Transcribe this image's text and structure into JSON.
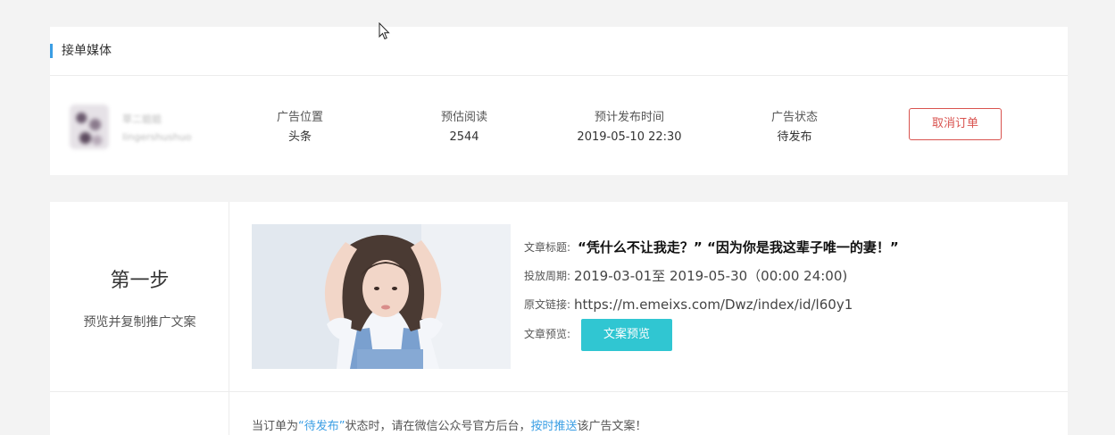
{
  "media_section": {
    "title": "接单媒体",
    "media": {
      "name": "草二姐姐",
      "account_id": "lingershushuo"
    },
    "stats": [
      {
        "label": "广告位置",
        "value": "头条"
      },
      {
        "label": "预估阅读",
        "value": "2544"
      },
      {
        "label": "预计发布时间",
        "value": "2019-05-10 22:30"
      },
      {
        "label": "广告状态",
        "value": "待发布"
      }
    ],
    "cancel_button": "取消订单"
  },
  "step1": {
    "title": "第一步",
    "subtitle": "预览并复制推广文案",
    "article": {
      "title_label": "文章标题:",
      "title": "“凭什么不让我走？” “因为你是我这辈子唯一的妻！”",
      "period_label": "投放周期:",
      "period": "2019-03-01至 2019-05-30（00:00 24:00)",
      "link_label": "原文链接:",
      "link": "https://m.emeixs.com/Dwz/index/id/l60y1",
      "preview_label": "文章预览:",
      "preview_button": "文案预览"
    }
  },
  "notice": {
    "prefix": "当订单为",
    "status": "“待发布”",
    "middle": "状态时，请在微信公众号官方后台，",
    "action": "按时推送",
    "suffix": "该广告文案！"
  },
  "colors": {
    "accent": "#3a9ee4",
    "danger": "#d9534f",
    "teal": "#30c6d2"
  }
}
